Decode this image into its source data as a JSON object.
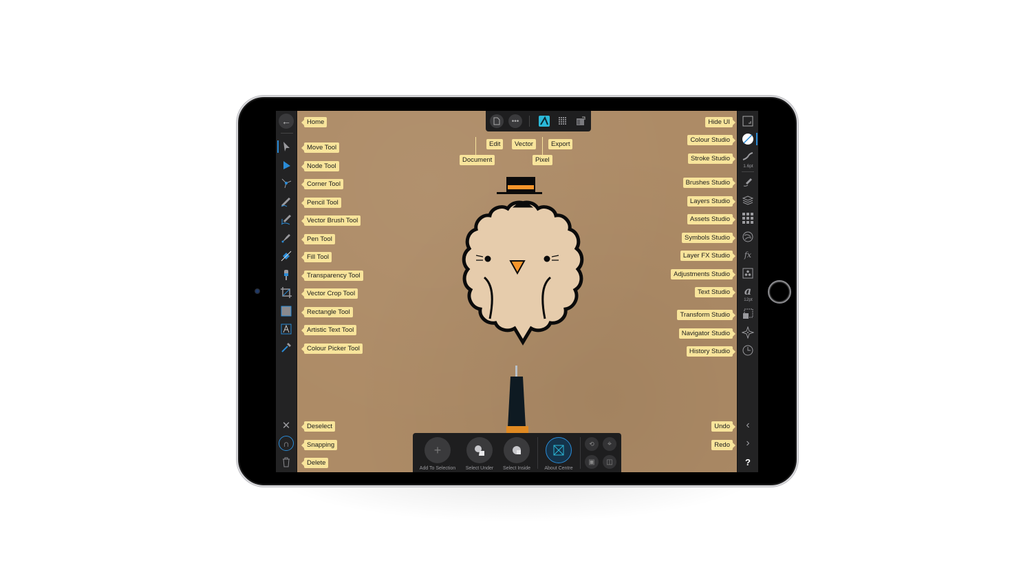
{
  "device": {
    "type": "iPad",
    "orientation": "landscape"
  },
  "app": {
    "name": "Affinity Designer",
    "colors": {
      "accent": "#2a8bd6",
      "callout_bg": "#f8e49b",
      "panel_bg": "#232324",
      "canvas_bg": "#ad8b66",
      "persona_vector": "#2bb8d8",
      "orange": "#f7952b"
    }
  },
  "left_toolbar": {
    "home": {
      "icon": "back-arrow-icon",
      "callout": "Home"
    },
    "tools": [
      {
        "id": "move",
        "icon": "move-arrow-icon",
        "callout": "Move Tool",
        "active": true
      },
      {
        "id": "node",
        "icon": "node-arrow-icon",
        "callout": "Node Tool"
      },
      {
        "id": "corner",
        "icon": "corner-icon",
        "callout": "Corner Tool"
      },
      {
        "id": "pencil",
        "icon": "pencil-icon",
        "callout": "Pencil Tool"
      },
      {
        "id": "vector-brush",
        "icon": "vector-brush-icon",
        "callout": "Vector Brush Tool"
      },
      {
        "id": "pen",
        "icon": "pen-nib-icon",
        "callout": "Pen Tool"
      },
      {
        "id": "fill",
        "icon": "fill-gradient-icon",
        "callout": "Fill Tool"
      },
      {
        "id": "transparency",
        "icon": "transparency-icon",
        "callout": "Transparency Tool"
      },
      {
        "id": "vector-crop",
        "icon": "crop-icon",
        "callout": "Vector Crop Tool"
      },
      {
        "id": "rectangle",
        "icon": "rectangle-icon",
        "callout": "Rectangle Tool"
      },
      {
        "id": "artistic-text",
        "icon": "artistic-text-icon",
        "callout": "Artistic Text Tool"
      },
      {
        "id": "colour-picker",
        "icon": "eyedropper-icon",
        "callout": "Colour Picker Tool"
      }
    ],
    "bottom": [
      {
        "id": "deselect",
        "icon": "x-icon",
        "callout": "Deselect"
      },
      {
        "id": "snapping",
        "icon": "magnet-icon",
        "callout": "Snapping"
      },
      {
        "id": "delete",
        "icon": "trash-icon",
        "callout": "Delete"
      }
    ]
  },
  "top_toolbar": {
    "items": [
      {
        "id": "document",
        "icon": "document-icon",
        "callout": "Document"
      },
      {
        "id": "edit",
        "icon": "more-dots-icon",
        "callout": "Edit"
      },
      {
        "id": "vector",
        "icon": "vector-persona-icon",
        "callout": "Vector",
        "active": true
      },
      {
        "id": "pixel",
        "icon": "pixel-grid-icon",
        "callout": "Pixel"
      },
      {
        "id": "export",
        "icon": "export-persona-icon",
        "callout": "Export"
      }
    ]
  },
  "right_toolbar": {
    "studios": [
      {
        "id": "hide-ui",
        "icon": "hide-ui-icon",
        "callout": "Hide UI"
      },
      {
        "id": "colour",
        "icon": "colour-swatch-icon",
        "callout": "Colour Studio",
        "active": true
      },
      {
        "id": "stroke",
        "icon": "stroke-icon",
        "callout": "Stroke Studio",
        "value": "1.6pt"
      },
      {
        "id": "brushes",
        "icon": "brush-icon",
        "callout": "Brushes Studio"
      },
      {
        "id": "layers",
        "icon": "layers-icon",
        "callout": "Layers Studio"
      },
      {
        "id": "assets",
        "icon": "assets-grid-icon",
        "callout": "Assets Studio"
      },
      {
        "id": "symbols",
        "icon": "symbols-icon",
        "callout": "Symbols Studio"
      },
      {
        "id": "layer-fx",
        "icon": "fx-icon",
        "callout": "Layer FX Studio"
      },
      {
        "id": "adjustments",
        "icon": "adjustments-icon",
        "callout": "Adjustments Studio"
      },
      {
        "id": "text",
        "icon": "text-a-icon",
        "callout": "Text Studio",
        "value": "12pt"
      },
      {
        "id": "transform",
        "icon": "transform-icon",
        "callout": "Transform Studio"
      },
      {
        "id": "navigator",
        "icon": "navigator-compass-icon",
        "callout": "Navigator Studio"
      },
      {
        "id": "history",
        "icon": "history-clock-icon",
        "callout": "History Studio"
      }
    ],
    "bottom": [
      {
        "id": "undo",
        "icon": "chevron-left-icon",
        "callout": "Undo"
      },
      {
        "id": "redo",
        "icon": "chevron-right-icon",
        "callout": "Redo"
      },
      {
        "id": "help",
        "icon": "help-question-icon",
        "label": "?"
      }
    ]
  },
  "context_toolbar": {
    "buttons": [
      {
        "id": "add-to-selection",
        "icon": "plus-icon",
        "label": "Add To Selection"
      },
      {
        "id": "select-under",
        "icon": "select-under-icon",
        "label": "Select Under"
      },
      {
        "id": "select-inside",
        "icon": "select-inside-icon",
        "label": "Select Inside"
      },
      {
        "id": "about-centre",
        "icon": "about-centre-icon",
        "label": "About Centre",
        "active": true
      }
    ],
    "small_buttons": [
      {
        "id": "transform-origin",
        "icon": "transform-origin-icon"
      },
      {
        "id": "crosshair",
        "icon": "crosshair-icon"
      },
      {
        "id": "bounding-box",
        "icon": "bounding-box-icon"
      },
      {
        "id": "view-toggle",
        "icon": "eye-frame-icon"
      }
    ]
  },
  "canvas": {
    "artwork": "fluffy-bird-with-top-hat",
    "props": [
      "pen-tip"
    ]
  }
}
